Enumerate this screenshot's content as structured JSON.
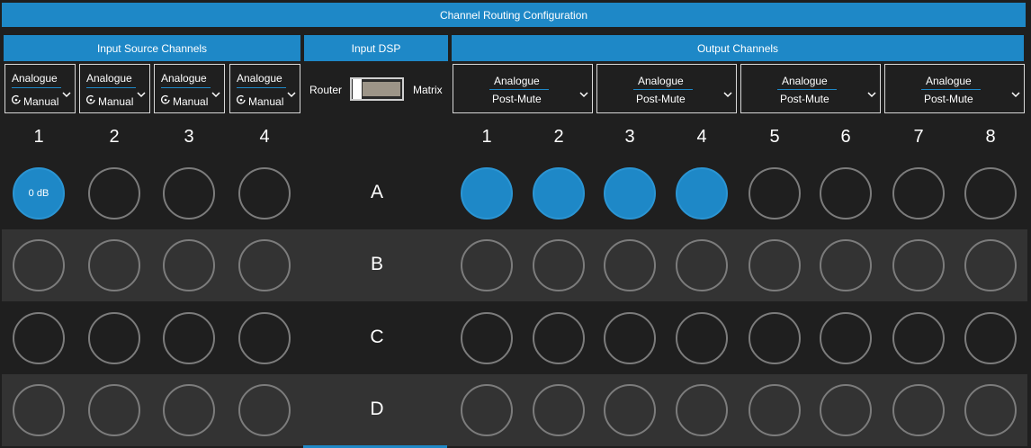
{
  "header": {
    "title": "Channel Routing Configuration"
  },
  "sections": {
    "input_source": "Input Source Channels",
    "input_dsp": "Input DSP",
    "output": "Output Channels"
  },
  "inputs": [
    {
      "number": "1",
      "source": "Analogue",
      "mode": "Manual"
    },
    {
      "number": "2",
      "source": "Analogue",
      "mode": "Manual"
    },
    {
      "number": "3",
      "source": "Analogue",
      "mode": "Manual"
    },
    {
      "number": "4",
      "source": "Analogue",
      "mode": "Manual"
    }
  ],
  "dsp": {
    "left_label": "Router",
    "right_label": "Matrix",
    "value": "Router"
  },
  "outputs": [
    {
      "number": "1",
      "source": "Analogue",
      "tap": "Post-Mute"
    },
    {
      "number": "2",
      "source": "Analogue",
      "tap": "Post-Mute"
    },
    {
      "number": "3",
      "source": "Analogue",
      "tap": "Post-Mute"
    },
    {
      "number": "4",
      "source": "Analogue",
      "tap": "Post-Mute"
    },
    {
      "number": "5"
    },
    {
      "number": "6"
    },
    {
      "number": "7"
    },
    {
      "number": "8"
    }
  ],
  "rows": [
    {
      "label": "A",
      "inputs_on": [
        true,
        false,
        false,
        false
      ],
      "input_text": [
        "0 dB",
        "",
        "",
        ""
      ],
      "outputs_on": [
        true,
        true,
        true,
        true,
        false,
        false,
        false,
        false
      ]
    },
    {
      "label": "B",
      "inputs_on": [
        false,
        false,
        false,
        false
      ],
      "input_text": [
        "",
        "",
        "",
        ""
      ],
      "outputs_on": [
        false,
        false,
        false,
        false,
        false,
        false,
        false,
        false
      ]
    },
    {
      "label": "C",
      "inputs_on": [
        false,
        false,
        false,
        false
      ],
      "input_text": [
        "",
        "",
        "",
        ""
      ],
      "outputs_on": [
        false,
        false,
        false,
        false,
        false,
        false,
        false,
        false
      ]
    },
    {
      "label": "D",
      "inputs_on": [
        false,
        false,
        false,
        false
      ],
      "input_text": [
        "",
        "",
        "",
        ""
      ],
      "outputs_on": [
        false,
        false,
        false,
        false,
        false,
        false,
        false,
        false
      ]
    }
  ],
  "colors": {
    "accent": "#1e88c7",
    "background": "#1f1f1f",
    "band": "#333333",
    "ring": "#7c7c7c"
  },
  "icons": {
    "mode": "knob-icon",
    "dropdown": "chevron-down-icon"
  }
}
